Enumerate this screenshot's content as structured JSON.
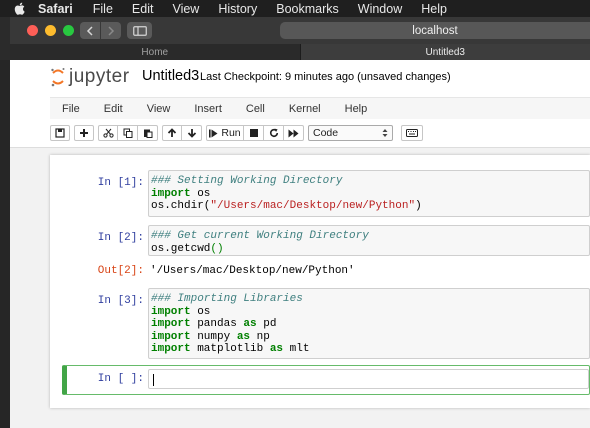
{
  "menubar": {
    "app": "Safari",
    "items": [
      "File",
      "Edit",
      "View",
      "History",
      "Bookmarks",
      "Window",
      "Help"
    ]
  },
  "browser": {
    "address": "localhost",
    "tabs": [
      {
        "label": "Home",
        "active": false
      },
      {
        "label": "Untitled3",
        "active": true
      }
    ]
  },
  "jupyter": {
    "logo_text": "jupyter",
    "notebook_name": "Untitled3",
    "checkpoint": "Last Checkpoint: 9 minutes ago  (unsaved changes)",
    "menu": [
      "File",
      "Edit",
      "View",
      "Insert",
      "Cell",
      "Kernel",
      "Help"
    ],
    "toolbar": {
      "run_label": "Run",
      "cell_type": "Code"
    }
  },
  "cells": [
    {
      "prompt": "In [1]:",
      "lines": [
        [
          {
            "t": "### Setting Working Directory",
            "c": "comment"
          }
        ],
        [
          {
            "t": "import",
            "c": "kw"
          },
          {
            "t": " os",
            "c": "var"
          }
        ],
        [
          {
            "t": "os.chdir(",
            "c": "var"
          },
          {
            "t": "\"/Users/mac/Desktop/new/Python\"",
            "c": "str"
          },
          {
            "t": ")",
            "c": "var"
          }
        ]
      ]
    },
    {
      "prompt": "In [2]:",
      "lines": [
        [
          {
            "t": "### Get current Working Directory",
            "c": "comment"
          }
        ],
        [
          {
            "t": "os.getcwd",
            "c": "var"
          },
          {
            "t": "()",
            "c": "brf"
          }
        ]
      ],
      "output_prompt": "Out[2]:",
      "output": "'/Users/mac/Desktop/new/Python'"
    },
    {
      "prompt": "In [3]:",
      "lines": [
        [
          {
            "t": "### Importing Libraries",
            "c": "comment"
          }
        ],
        [
          {
            "t": "import",
            "c": "kw"
          },
          {
            "t": " os",
            "c": "var"
          }
        ],
        [
          {
            "t": "import",
            "c": "kw"
          },
          {
            "t": " pandas ",
            "c": "var"
          },
          {
            "t": "as",
            "c": "kw"
          },
          {
            "t": " pd",
            "c": "var"
          }
        ],
        [
          {
            "t": "import",
            "c": "kw"
          },
          {
            "t": " numpy ",
            "c": "var"
          },
          {
            "t": "as",
            "c": "kw"
          },
          {
            "t": " np",
            "c": "var"
          }
        ],
        [
          {
            "t": "import",
            "c": "kw"
          },
          {
            "t": " matplotlib ",
            "c": "var"
          },
          {
            "t": "as",
            "c": "kw"
          },
          {
            "t": " mlt",
            "c": "var"
          }
        ]
      ]
    }
  ],
  "empty_cell_prompt": "In [ ]:"
}
